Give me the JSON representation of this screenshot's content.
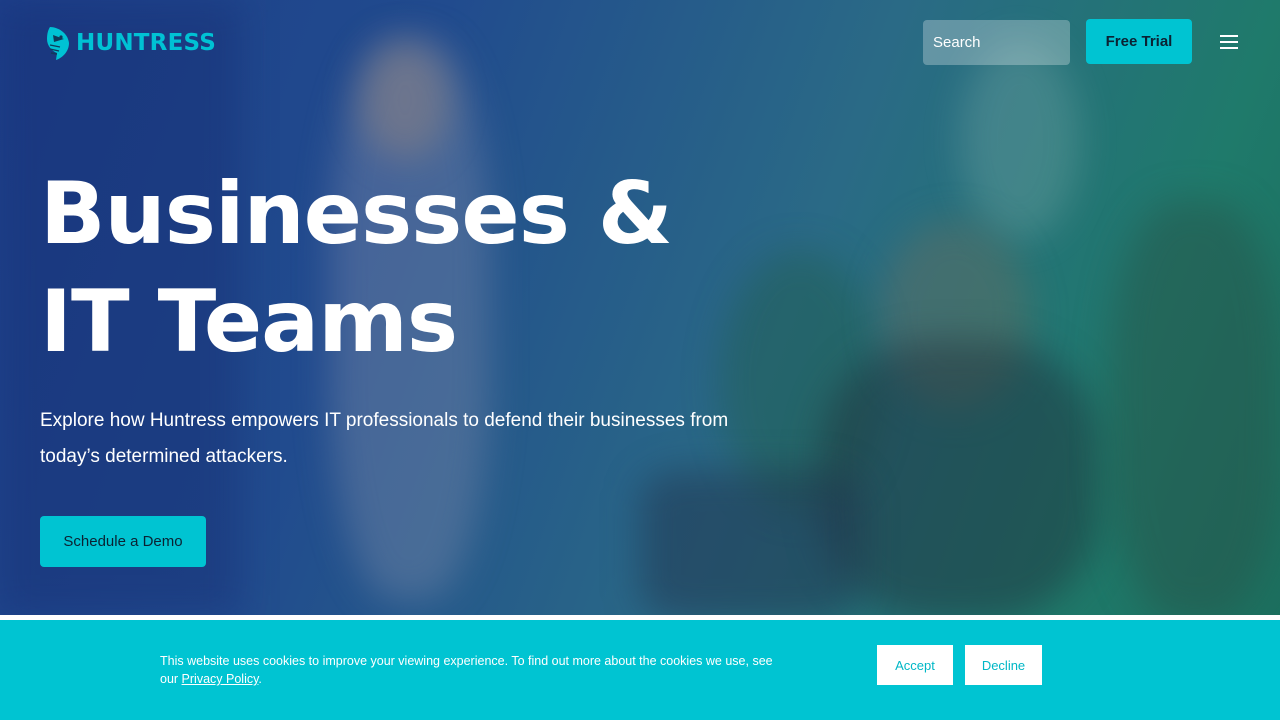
{
  "header": {
    "logo_text": "HUNTRESS",
    "search_placeholder": "Search",
    "free_trial_label": "Free Trial"
  },
  "hero": {
    "headline_line1": "Businesses &",
    "headline_line2": "IT Teams",
    "description": "Explore how Huntress empowers IT professionals to defend their businesses from today’s determined attackers.",
    "cta_label": "Schedule a Demo"
  },
  "cookie_banner": {
    "text_before_link": "This website uses cookies to improve your viewing experience. To find out more about the cookies we use, see our ",
    "privacy_link": "Privacy Policy",
    "text_after_link": ".",
    "accept_label": "Accept",
    "decline_label": "Decline"
  },
  "colors": {
    "brand_cyan": "#00c4d2",
    "hero_gradient_left": "#1d3f8a",
    "hero_gradient_right": "#1c6f5e",
    "text_on_hero": "#ffffff"
  },
  "icons": {
    "logo": "huntress-hawk-logo-icon",
    "menu": "hamburger-menu-icon"
  }
}
